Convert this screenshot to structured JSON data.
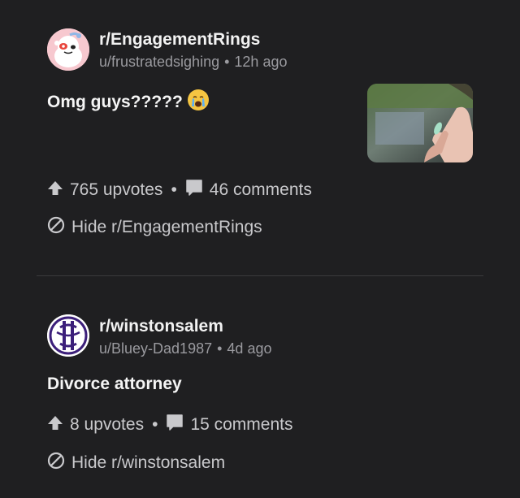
{
  "posts": [
    {
      "subreddit": "r/EngagementRings",
      "username": "u/frustratedsighing",
      "age": "12h ago",
      "title": "Omg guys?????",
      "upvotes": "765 upvotes",
      "comments": "46 comments",
      "hide_label": "Hide r/EngagementRings",
      "avatar_icon": "snoo-avatar-icon",
      "title_emoji": "crying-face-emoji"
    },
    {
      "subreddit": "r/winstonsalem",
      "username": "u/Bluey-Dad1987",
      "age": "4d ago",
      "title": "Divorce attorney",
      "upvotes": "8 upvotes",
      "comments": "15 comments",
      "hide_label": "Hide r/winstonsalem",
      "avatar_icon": "winston-salem-logo-icon"
    }
  ],
  "colors": {
    "background": "#1f1f21",
    "text_primary": "#f2f2f2",
    "text_secondary": "#9a9a9f",
    "divider": "#3a3a3c",
    "logo_purple": "#4b2a8c"
  }
}
